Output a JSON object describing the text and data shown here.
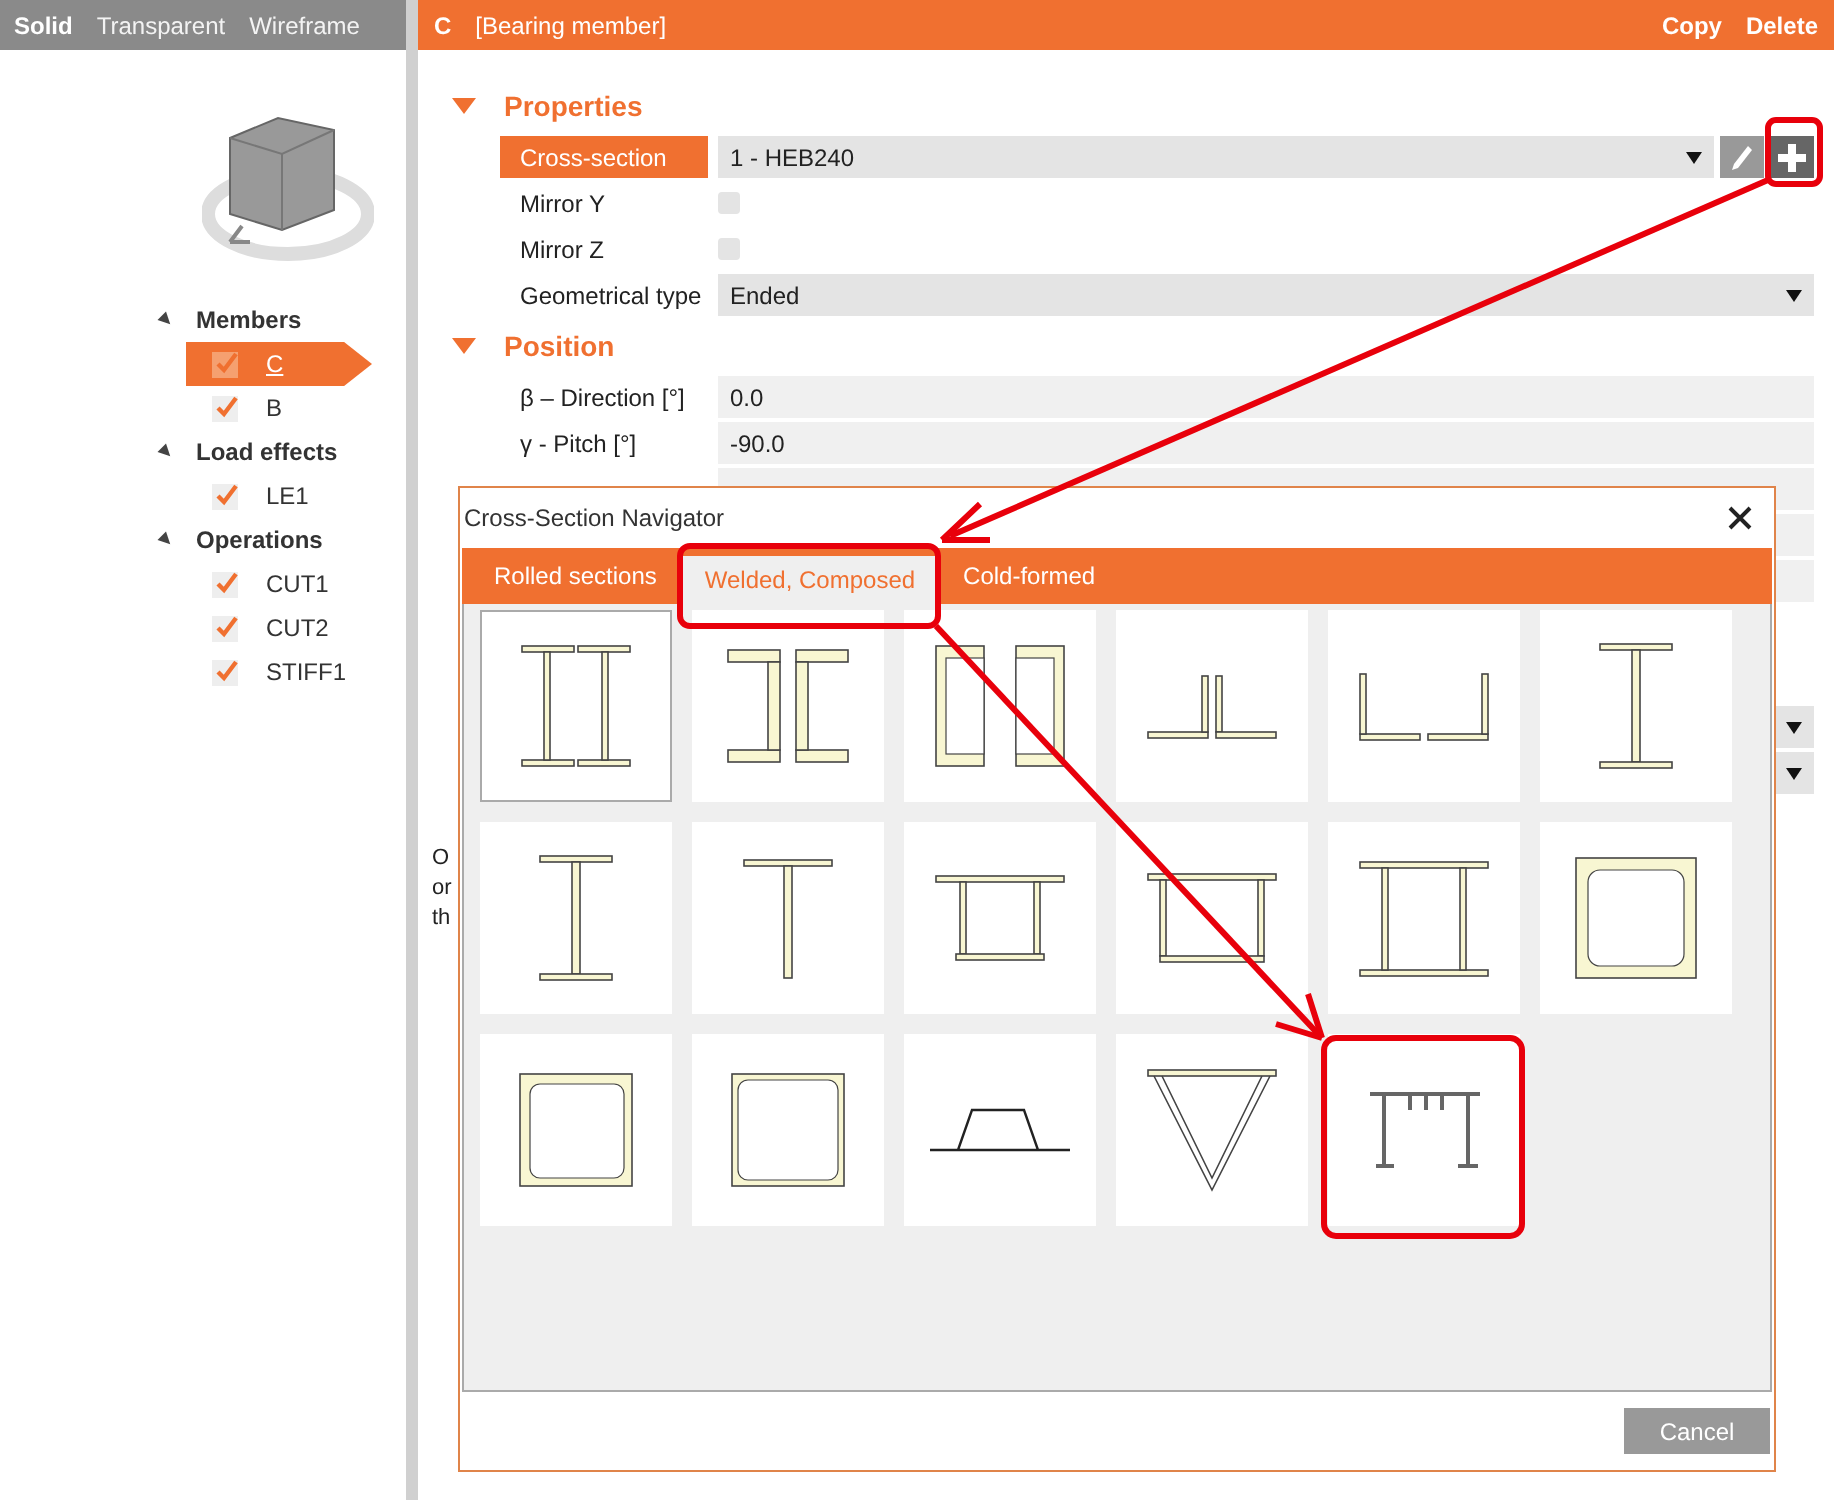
{
  "view_modes": [
    {
      "label": "Solid",
      "selected": true
    },
    {
      "label": "Transparent",
      "selected": false
    },
    {
      "label": "Wireframe",
      "selected": false
    }
  ],
  "tree": [
    {
      "label": "Members",
      "expanded": true,
      "children": [
        {
          "label": "C",
          "checked": true,
          "selected": true
        },
        {
          "label": "B",
          "checked": true,
          "selected": false
        }
      ]
    },
    {
      "label": "Load effects",
      "expanded": true,
      "children": [
        {
          "label": "LE1",
          "checked": true,
          "selected": false
        }
      ]
    },
    {
      "label": "Operations",
      "expanded": true,
      "children": [
        {
          "label": "CUT1",
          "checked": true,
          "selected": false
        },
        {
          "label": "CUT2",
          "checked": true,
          "selected": false
        },
        {
          "label": "STIFF1",
          "checked": true,
          "selected": false
        }
      ]
    }
  ],
  "header": {
    "name": "C",
    "type": "[Bearing member]",
    "actions": [
      "Copy",
      "Delete"
    ]
  },
  "properties": {
    "title": "Properties",
    "expanded": true,
    "cross_section": {
      "label": "Cross-section",
      "value": "1 - HEB240"
    },
    "mirror_y": {
      "label": "Mirror Y",
      "checked": false
    },
    "mirror_z": {
      "label": "Mirror Z",
      "checked": false
    },
    "geometrical_type": {
      "label": "Geometrical type",
      "value": "Ended"
    }
  },
  "position": {
    "title": "Position",
    "expanded": true,
    "rows": [
      {
        "label": "β – Direction [°]",
        "value": "0.0"
      },
      {
        "label": "γ - Pitch [°]",
        "value": "-90.0"
      }
    ]
  },
  "hidden_text": [
    "O",
    "or",
    "th"
  ],
  "dialog": {
    "title": "Cross-Section Navigator",
    "tabs": [
      {
        "label": "Rolled sections",
        "selected": false
      },
      {
        "label": "Welded, Composed",
        "selected": true
      },
      {
        "label": "Cold-formed",
        "selected": false
      }
    ],
    "tiles": [
      {
        "kind": "double-i",
        "selected": true
      },
      {
        "kind": "channels-back",
        "selected": false
      },
      {
        "kind": "channels-facing",
        "selected": false
      },
      {
        "kind": "angles-back",
        "selected": false
      },
      {
        "kind": "angles-apart",
        "selected": false
      },
      {
        "kind": "i-beam",
        "selected": false
      },
      {
        "kind": "i-beam",
        "selected": false
      },
      {
        "kind": "tee",
        "selected": false
      },
      {
        "kind": "box-girder",
        "selected": false
      },
      {
        "kind": "open-box",
        "selected": false
      },
      {
        "kind": "double-i-joined",
        "selected": false
      },
      {
        "kind": "welded-box",
        "selected": false
      },
      {
        "kind": "channel-box",
        "selected": false
      },
      {
        "kind": "angle-box",
        "selected": false
      },
      {
        "kind": "hat",
        "selected": false
      },
      {
        "kind": "v-section",
        "selected": false
      },
      {
        "kind": "stiffened-deck",
        "selected": false
      }
    ],
    "buttons": [
      "Cancel"
    ]
  }
}
